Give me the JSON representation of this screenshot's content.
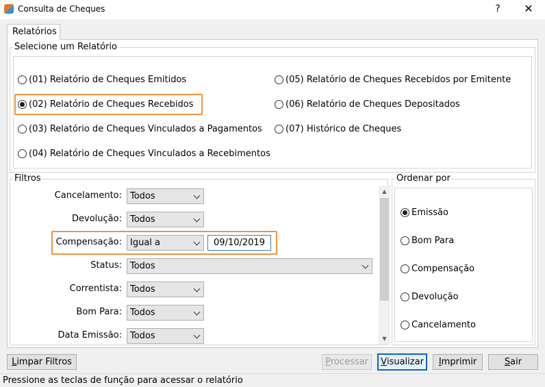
{
  "window": {
    "title": "Consulta de Cheques",
    "help_label": "?",
    "close_label": "✕"
  },
  "tab": {
    "label": "Relatórios"
  },
  "report_group": {
    "title": "Selecione um Relatório",
    "options": [
      {
        "label": "(01) Relatório de Cheques Emitidos",
        "checked": false
      },
      {
        "label": "(02) Relatório de Cheques Recebidos",
        "checked": true
      },
      {
        "label": "(03) Relatório de Cheques Vinculados a Pagamentos",
        "checked": false
      },
      {
        "label": "(04) Relatório de Cheques Vinculados a Recebimentos",
        "checked": false
      },
      {
        "label": "(05) Relatório de Cheques Recebidos por Emitente",
        "checked": false
      },
      {
        "label": "(06) Relatório de Cheques Depositados",
        "checked": false
      },
      {
        "label": "(07) Histórico de Cheques",
        "checked": false
      }
    ]
  },
  "filters": {
    "title": "Filtros",
    "rows": [
      {
        "label": "Cancelamento:",
        "value": "Todos"
      },
      {
        "label": "Devolução:",
        "value": "Todos"
      },
      {
        "label": "Compensação:",
        "value": "Igual a",
        "date": "09/10/2019"
      },
      {
        "label": "Status:",
        "value": "Todos"
      },
      {
        "label": "Correntista:",
        "value": "Todos"
      },
      {
        "label": "Bom Para:",
        "value": "Todos"
      },
      {
        "label": "Data Emissão:",
        "value": "Todos"
      }
    ]
  },
  "order": {
    "title": "Ordenar por",
    "options": [
      {
        "label": "Emissão",
        "checked": true
      },
      {
        "label": "Bom Para",
        "checked": false
      },
      {
        "label": "Compensação",
        "checked": false
      },
      {
        "label": "Devolução",
        "checked": false
      },
      {
        "label": "Cancelamento",
        "checked": false
      }
    ]
  },
  "buttons": {
    "clear": {
      "mnemonic": "L",
      "rest": "impar Filtros"
    },
    "process": {
      "mnemonic": "P",
      "rest": "rocessar"
    },
    "view": {
      "mnemonic": "V",
      "rest": "isualizar"
    },
    "print": {
      "mnemonic": "I",
      "rest": "mprimir"
    },
    "exit": {
      "mnemonic": "S",
      "rest": "air"
    }
  },
  "status_bar": {
    "text": "Pressione as teclas de função para acessar o relatório"
  },
  "colors": {
    "highlight": "#f0923e",
    "default_button_border": "#0a64c4"
  }
}
